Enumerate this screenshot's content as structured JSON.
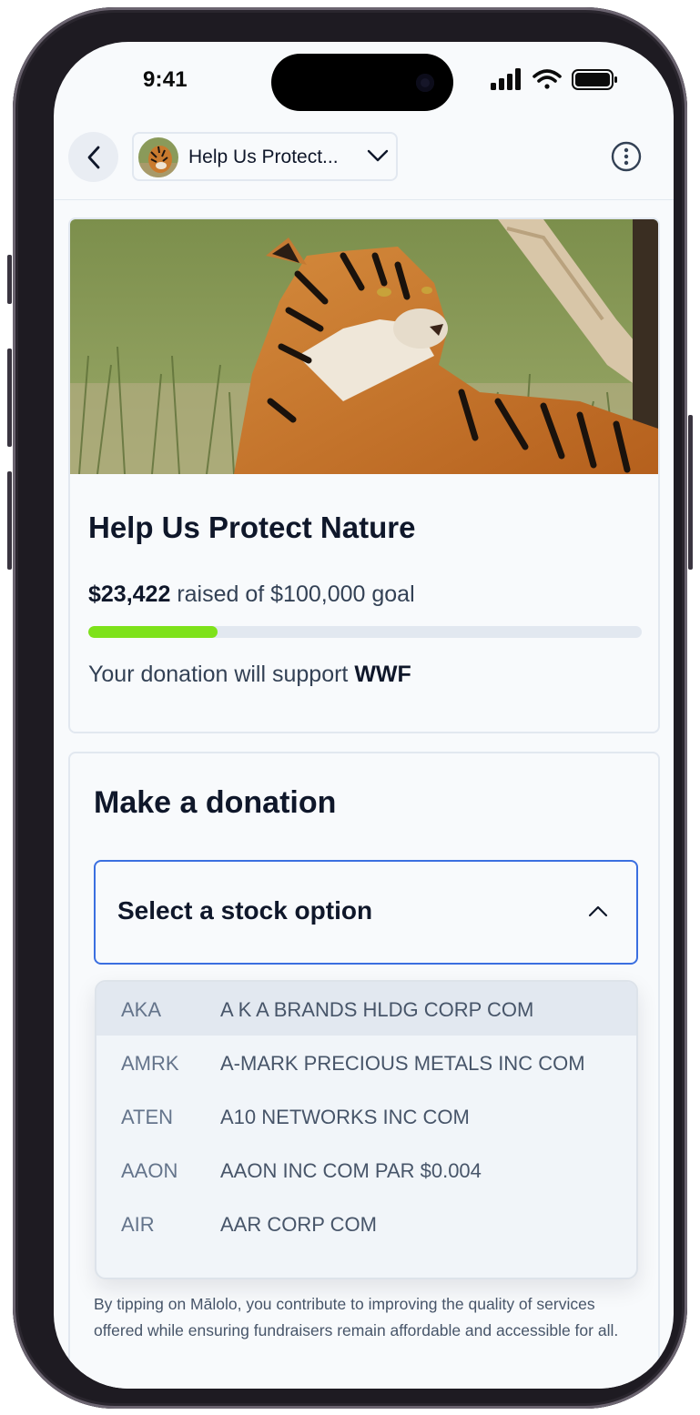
{
  "status_bar": {
    "time": "9:41"
  },
  "header": {
    "campaign_title_short": "Help Us Protect...",
    "back_icon": "chevron-left-icon",
    "dropdown_icon": "chevron-down-icon",
    "more_icon": "more-vertical-icon"
  },
  "campaign": {
    "title": "Help Us Protect Nature",
    "raised_amount": "$23,422",
    "raised_text": " raised of $100,000 goal",
    "progress_fraction": 0.2342,
    "support_prefix": "Your donation will support ",
    "beneficiary": "WWF",
    "hero_image": "tiger-photo"
  },
  "donation": {
    "title": "Make a donation",
    "select_label": "Select a stock option",
    "select_icon": "chevron-up-icon",
    "options": [
      {
        "ticker": "AKA",
        "name": "A K A BRANDS HLDG CORP COM"
      },
      {
        "ticker": "AMRK",
        "name": "A-MARK PRECIOUS METALS INC COM"
      },
      {
        "ticker": "ATEN",
        "name": "A10 NETWORKS INC COM"
      },
      {
        "ticker": "AAON",
        "name": "AAON INC COM PAR $0.004"
      },
      {
        "ticker": "AIR",
        "name": "AAR CORP COM"
      }
    ],
    "tip_note": "By tipping on Mālolo, you contribute to improving the quality of services offered while ensuring fundraisers remain affordable and accessible for all."
  },
  "colors": {
    "accent": "#3b6fe0",
    "progress": "#7ee21a",
    "text": "#0f172a"
  }
}
